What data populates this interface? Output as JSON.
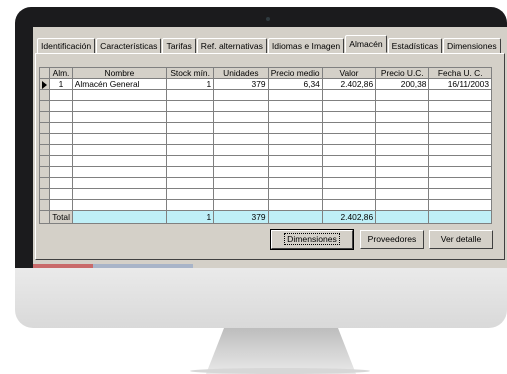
{
  "tabs": [
    {
      "label": "Identificación",
      "active": false
    },
    {
      "label": "Características",
      "active": false
    },
    {
      "label": "Tarifas",
      "active": false
    },
    {
      "label": "Ref. alternativas",
      "active": false
    },
    {
      "label": "Idiomas e Imagen",
      "active": false
    },
    {
      "label": "Almacén",
      "active": true
    },
    {
      "label": "Estadísticas",
      "active": false
    },
    {
      "label": "Dimensiones",
      "active": false
    }
  ],
  "grid": {
    "columns": [
      "Alm.",
      "Nombre",
      "Stock mín.",
      "Unidades",
      "Precio medio",
      "Valor",
      "Precio U.C.",
      "Fecha U. C."
    ],
    "rows": [
      {
        "alm": "1",
        "nombre": "Almacén General",
        "stock_min": "1",
        "unidades": "379",
        "precio_medio": "6,34",
        "valor": "2.402,86",
        "precio_uc": "200,38",
        "fecha_uc": "16/11/2003"
      }
    ],
    "total": {
      "label": "Total",
      "stock_min": "1",
      "unidades": "379",
      "valor": "2.402,86"
    }
  },
  "buttons": {
    "dimensiones": "Dimensiones",
    "proveedores": "Proveedores",
    "ver_detalle": "Ver detalle"
  },
  "colors": {
    "window_bg": "#d4d0c8",
    "total_row": "#bfeff7",
    "bezel": "#1b1b1d"
  }
}
